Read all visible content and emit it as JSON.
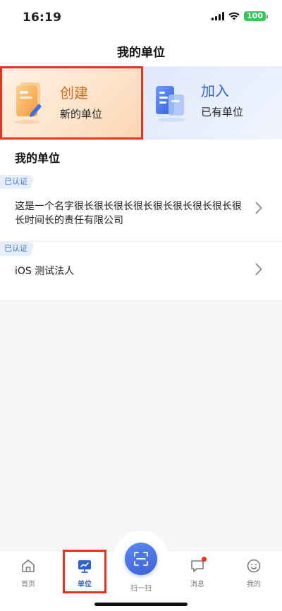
{
  "status_bar": {
    "time": "16:19",
    "battery": "100"
  },
  "header": {
    "title": "我的单位"
  },
  "actions": {
    "create": {
      "title": "创建",
      "subtitle": "新的单位"
    },
    "join": {
      "title": "加入",
      "subtitle": "已有单位"
    }
  },
  "section": {
    "title": "我的单位"
  },
  "units": [
    {
      "badge": "已认证",
      "name": "这是一个名字很长很长很长很长很长很长很长很长很长时间长的责任有限公司"
    },
    {
      "badge": "已认证",
      "name": "iOS 测试法人"
    }
  ],
  "tabbar": {
    "home": "首页",
    "unit": "单位",
    "scan": "扫一扫",
    "messages": "消息",
    "me": "我的"
  },
  "colors": {
    "accent": "#2f5fd6",
    "create": "#d8691f",
    "highlight": "#e8321f"
  }
}
